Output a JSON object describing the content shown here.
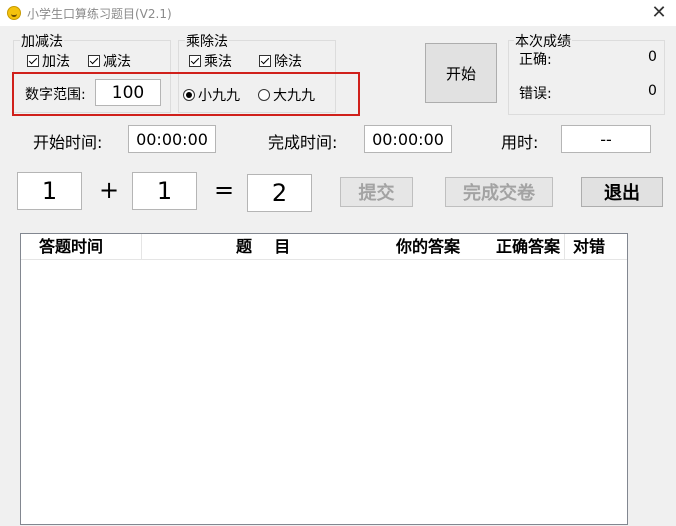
{
  "window": {
    "title": "小学生口算练习题目(V2.1)",
    "close_label": "✕"
  },
  "add_sub": {
    "label": "加减法",
    "add": "加法",
    "sub": "减法",
    "add_checked": true,
    "sub_checked": true
  },
  "range": {
    "label": "数字范围:",
    "value": "100"
  },
  "mul_div": {
    "label": "乘除法",
    "mul": "乘法",
    "div": "除法",
    "mul_checked": true,
    "div_checked": true,
    "small_table": "小九九",
    "big_table": "大九九",
    "selected": "small"
  },
  "start_button": "开始",
  "score": {
    "label": "本次成绩",
    "correct_label": "正确:",
    "correct_value": "0",
    "wrong_label": "错误:",
    "wrong_value": "0"
  },
  "times": {
    "start_label": "开始时间:",
    "start_value": "00:00:00",
    "finish_label": "完成时间:",
    "finish_value": "00:00:00",
    "used_label": "用时:",
    "used_value": "--"
  },
  "problem": {
    "a": "1",
    "op": "+",
    "b": "1",
    "eq": "=",
    "answer": "2"
  },
  "buttons": {
    "submit": "提交",
    "finish": "完成交卷",
    "exit": "退出"
  },
  "table": {
    "columns": [
      "答题时间",
      "题    目",
      "你的答案",
      "正确答案",
      "对错"
    ]
  },
  "colors": {
    "highlight": "#d0201b"
  }
}
